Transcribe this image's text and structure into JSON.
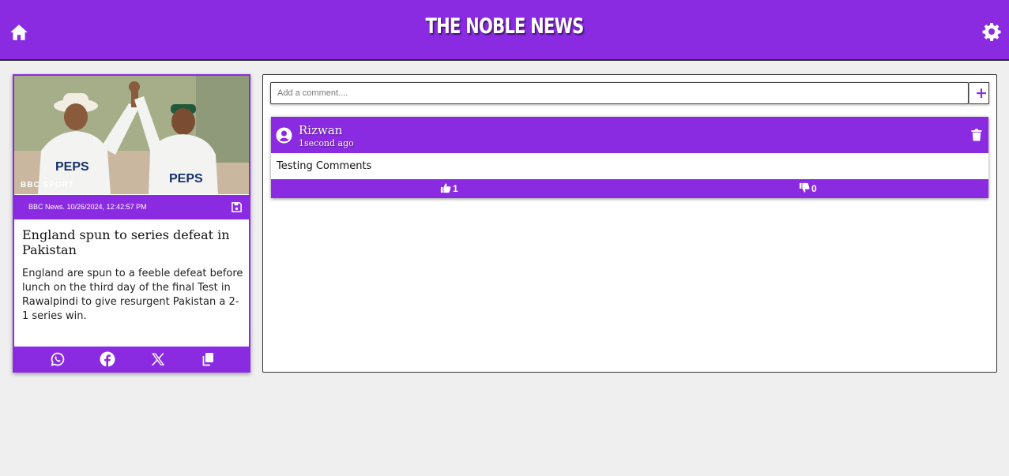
{
  "header": {
    "brand": "THE NOBLE NEWS",
    "home_icon": "home-icon",
    "settings_icon": "gear-icon"
  },
  "article": {
    "image_watermark": "BBC SPORT",
    "image_description": "Cricketers celebrating",
    "source_line": "BBC News. 10/26/2024, 12:42:57 PM",
    "title": "England spun to series defeat in Pakistan",
    "description": "England are spun to a feeble defeat before lunch on the third day of the final Test in Rawalpindi to give resurgent Pakistan a 2-1 series win.",
    "share_icons": [
      "whatsapp-icon",
      "facebook-icon",
      "x-icon",
      "copy-icon"
    ]
  },
  "comments_panel": {
    "input_placeholder": "Add a comment....",
    "add_label": "+",
    "comments": [
      {
        "author": "Rizwan",
        "time": "1second ago",
        "text": "Testing Comments",
        "likes": "1",
        "dislikes": "0"
      }
    ]
  },
  "colors": {
    "accent": "#8a2be2",
    "background": "#efefef"
  }
}
